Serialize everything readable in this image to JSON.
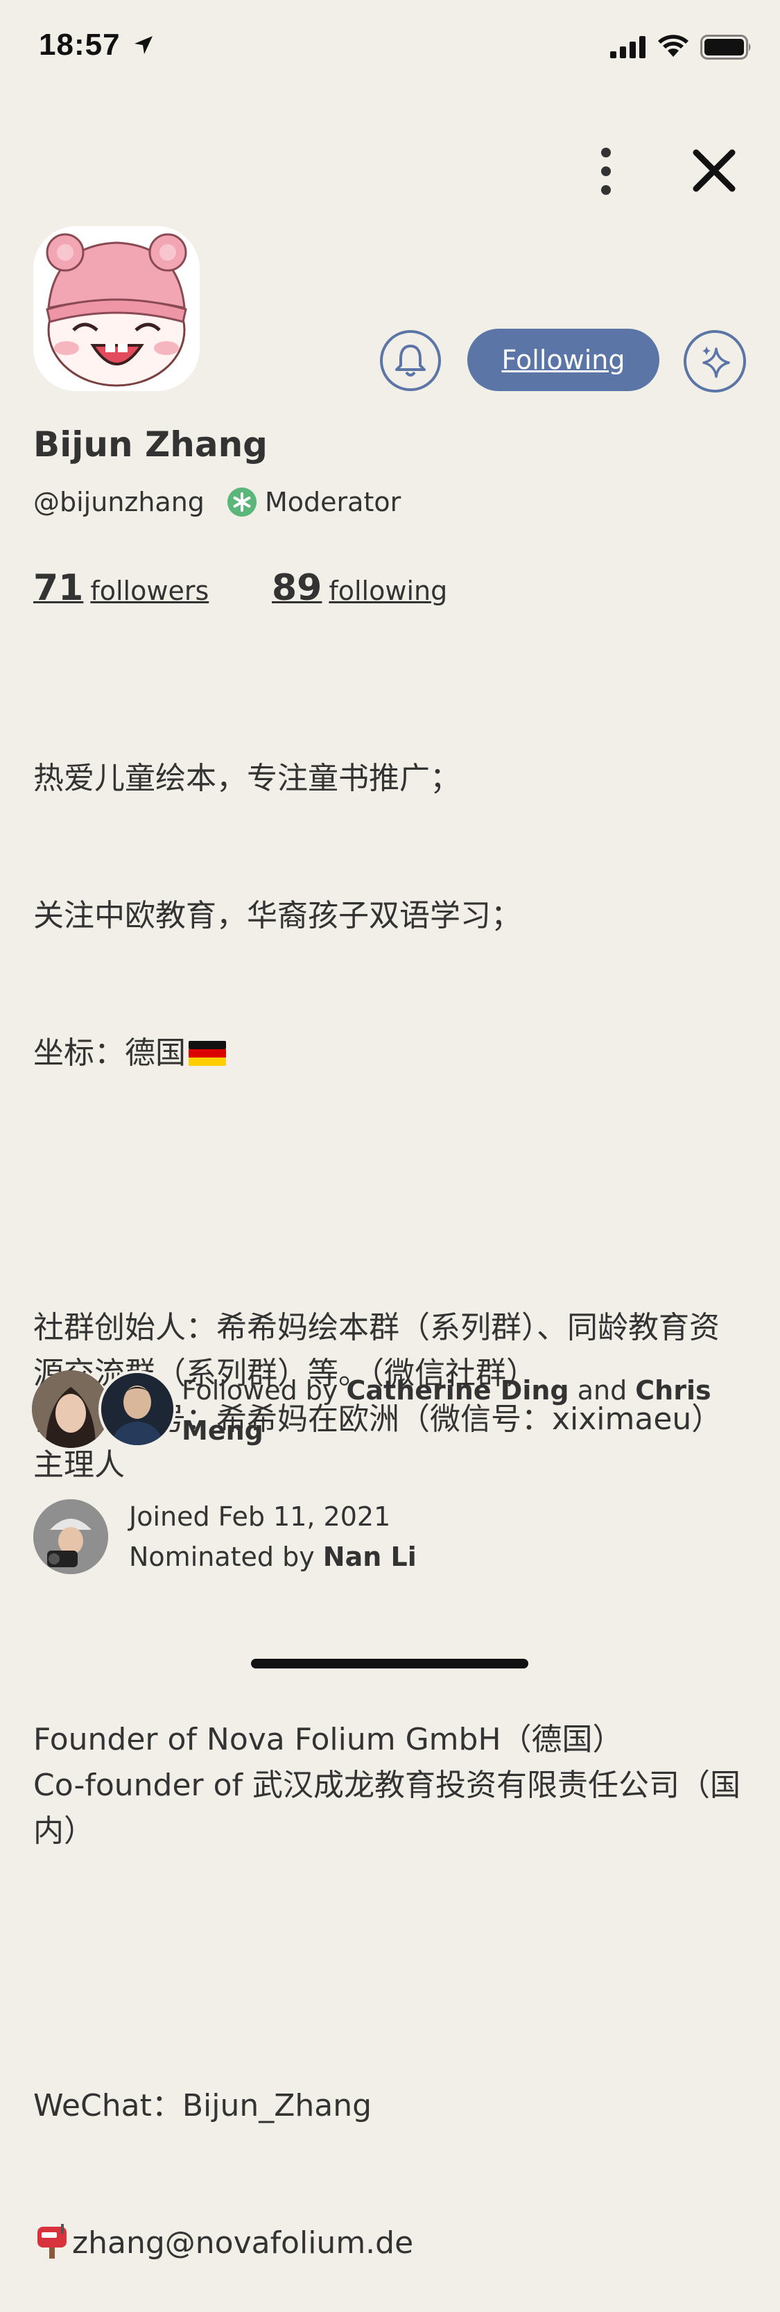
{
  "status_bar": {
    "time": "18:57"
  },
  "profile": {
    "name": "Bijun Zhang",
    "handle": "@bijunzhang",
    "role": "Moderator",
    "followers_count": "71",
    "followers_label": "followers",
    "following_count": "89",
    "following_label": "following",
    "follow_button_label": "Following"
  },
  "bio": {
    "line1": "热爱儿童绘本，专注童书推广；",
    "line2": "关注中欧教育，华裔孩子双语学习；",
    "line3": "坐标：德国",
    "para2": "社群创始人：希希妈绘本群（系列群）、同龄教育资源交流群（系列群）等。（微信社群）\n微信公众号：希希妈在欧洲（微信号：xiximaeu）主理人",
    "para3": "Founder of Nova Folium GmbH（德国）\nCo-founder of 武汉成龙教育投资有限责任公司（国内）",
    "wechat": "WeChat：Bijun_Zhang",
    "email": "zhang@novafolium.de"
  },
  "mutual": {
    "prefix": "Followed by ",
    "name1": "Catherine Ding",
    "joiner": " and ",
    "name2": "Chris Meng"
  },
  "joined": {
    "date_text": "Joined Feb 11, 2021",
    "nominated_prefix": "Nominated by ",
    "nominator": "Nan Li"
  },
  "colors": {
    "background": "#F1EFE7",
    "accent": "#5A75A6",
    "moderator": "#5BB67A"
  },
  "icons": [
    "location-arrow-icon",
    "signal-icon",
    "wifi-icon",
    "battery-icon",
    "more-vertical-icon",
    "close-icon",
    "bell-icon",
    "sparkle-icon",
    "moderator-asterisk-icon",
    "germany-flag-icon",
    "mailbox-icon"
  ]
}
